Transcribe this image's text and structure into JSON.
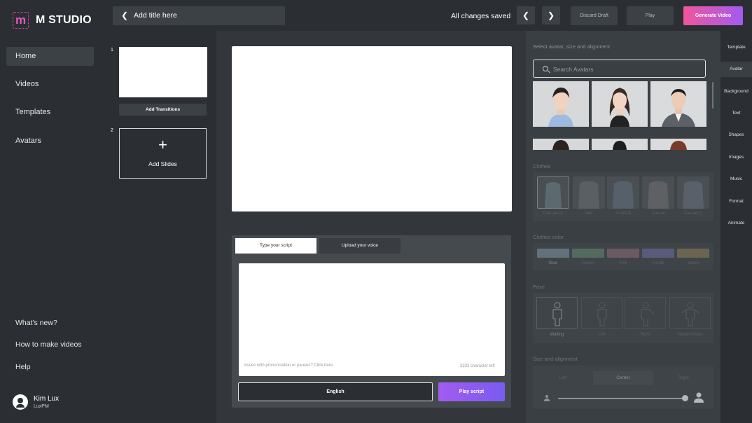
{
  "brand": {
    "logo_letter": "m",
    "name": "M STUDIO"
  },
  "sidebar": {
    "nav": [
      {
        "label": "Home",
        "active": true
      },
      {
        "label": "Videos",
        "active": false
      },
      {
        "label": "Templates",
        "active": false
      },
      {
        "label": "Avatars",
        "active": false
      }
    ],
    "footer": [
      {
        "label": "What's new?"
      },
      {
        "label": "How to make videos"
      },
      {
        "label": "Help"
      }
    ],
    "user": {
      "name": "Kim Lux",
      "org": "LuxPM"
    }
  },
  "topbar": {
    "title_placeholder": "Add title here",
    "status": "All changes saved",
    "discard_label": "Discard Draft",
    "play_label": "Play",
    "generate_label": "Generate Video"
  },
  "slides": {
    "items": [
      {
        "number": "1"
      },
      {
        "number": "2"
      }
    ],
    "add_transitions_label": "Add Transitions",
    "add_slides_label": "Add Slides"
  },
  "script": {
    "tabs": [
      {
        "label": "Type your script",
        "active": true
      },
      {
        "label": "Upload your voice",
        "active": false
      }
    ],
    "hint": "Issues with pronunciation or pauses? Click here.",
    "char_left": "3333 character left",
    "language": "English",
    "play_label": "Play script"
  },
  "right_panel": {
    "heading": "Select avatar, size and alignment",
    "search_placeholder": "Search Avatars",
    "clothes_title": "Clothes",
    "clothes": [
      "One-piece",
      "Suit",
      "Suit(full)",
      "Casual",
      "Casual(2)"
    ],
    "clothes_color_title": "Clothes color",
    "colors": [
      {
        "label": "Blue",
        "hex": "#62717a"
      },
      {
        "label": "Green",
        "hex": "#536a5f"
      },
      {
        "label": "Pink",
        "hex": "#6a5a61"
      },
      {
        "label": "Purple",
        "hex": "#585c7a"
      },
      {
        "label": "Yellow",
        "hex": "#6b6450"
      }
    ],
    "pose_title": "Pose",
    "poses": [
      "Waiting",
      "Left",
      "Right",
      "Hands-folded"
    ],
    "size_title": "Size and alignment",
    "align": [
      "Left",
      "Center",
      "Right"
    ],
    "size_level": 0.99
  },
  "rail": [
    "Template",
    "Avatar",
    "Background",
    "Text",
    "Shapes",
    "Images",
    "Music",
    "Format",
    "Animate"
  ],
  "rail_active": "Avatar"
}
